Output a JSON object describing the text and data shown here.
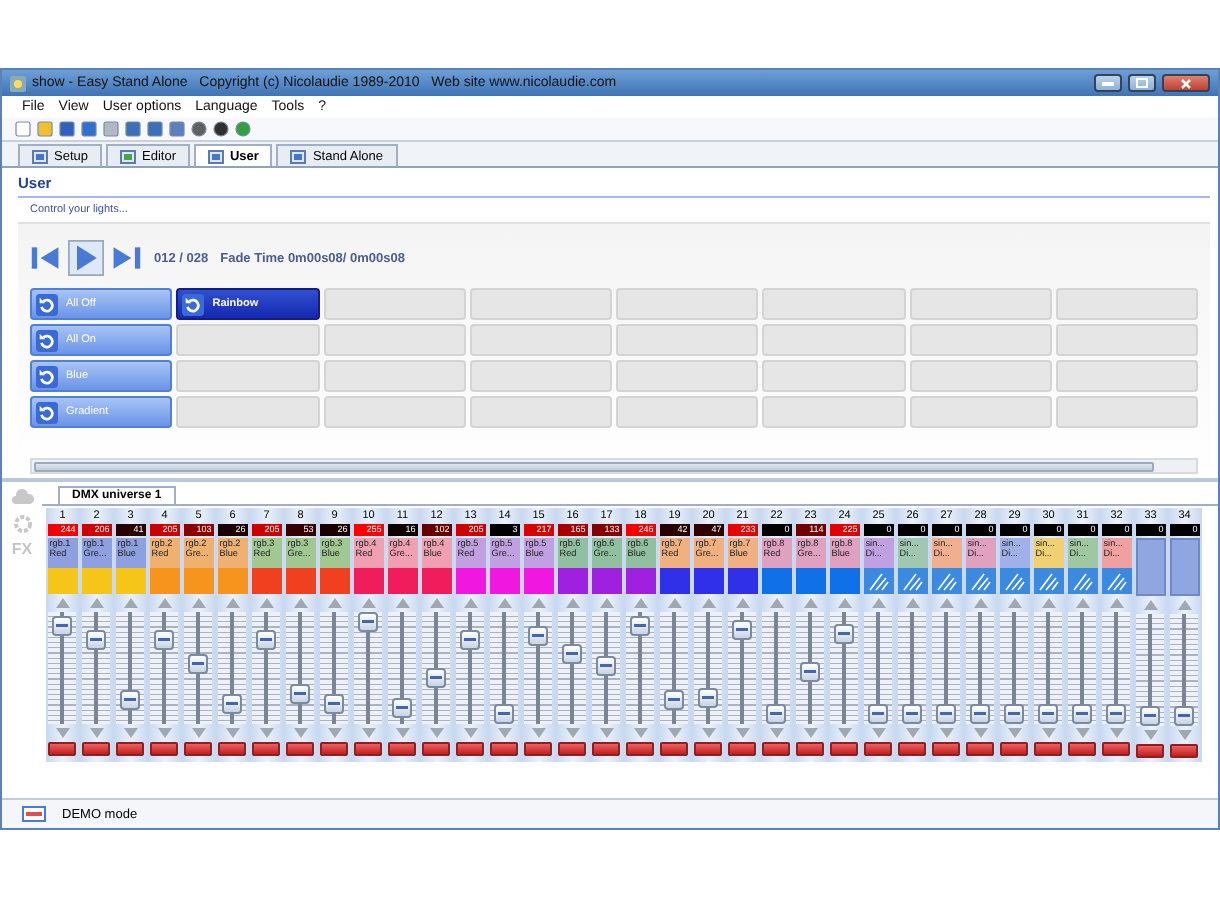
{
  "window": {
    "title": "show - Easy Stand Alone   Copyright (c) Nicolaudie 1989-2010   Web site www.nicolaudie.com"
  },
  "menu": [
    "File",
    "View",
    "User options",
    "Language",
    "Tools",
    "?"
  ],
  "tabs": [
    {
      "label": "Setup",
      "selected": false
    },
    {
      "label": "Editor",
      "selected": false
    },
    {
      "label": "User",
      "selected": true
    },
    {
      "label": "Stand Alone",
      "selected": false
    }
  ],
  "user_panel": {
    "title": "User",
    "subtitle": "Control your lights...",
    "counter": "012 / 028",
    "fade_time": "Fade Time 0m00s08/ 0m00s08",
    "rows": [
      [
        {
          "kind": "scene",
          "label": "All Off",
          "selected": false
        },
        {
          "kind": "scene",
          "label": "Rainbow",
          "selected": true
        },
        {
          "kind": "empty"
        },
        {
          "kind": "empty"
        },
        {
          "kind": "empty"
        },
        {
          "kind": "empty"
        },
        {
          "kind": "empty"
        },
        {
          "kind": "empty"
        }
      ],
      [
        {
          "kind": "scene",
          "label": "All On",
          "selected": false
        },
        {
          "kind": "empty"
        },
        {
          "kind": "empty"
        },
        {
          "kind": "empty"
        },
        {
          "kind": "empty"
        },
        {
          "kind": "empty"
        },
        {
          "kind": "empty"
        },
        {
          "kind": "empty"
        }
      ],
      [
        {
          "kind": "scene",
          "label": "Blue",
          "selected": false
        },
        {
          "kind": "empty"
        },
        {
          "kind": "empty"
        },
        {
          "kind": "empty"
        },
        {
          "kind": "empty"
        },
        {
          "kind": "empty"
        },
        {
          "kind": "empty"
        },
        {
          "kind": "empty"
        }
      ],
      [
        {
          "kind": "scene",
          "label": "Gradient",
          "selected": false
        },
        {
          "kind": "empty"
        },
        {
          "kind": "empty"
        },
        {
          "kind": "empty"
        },
        {
          "kind": "empty"
        },
        {
          "kind": "empty"
        },
        {
          "kind": "empty"
        },
        {
          "kind": "empty"
        }
      ]
    ]
  },
  "dmx": {
    "side_label": "FX",
    "tab": "DMX universe 1",
    "channels": [
      {
        "number": "1",
        "value": "244",
        "level": 0.96,
        "kind": "rgb",
        "tag": {
          "label": "rgb.1 Red",
          "color": "#8fa0e0"
        },
        "color": "#f5c518"
      },
      {
        "number": "2",
        "value": "206",
        "level": 0.81,
        "kind": "rgb",
        "tag": {
          "label": "rgb.1 Gre...",
          "color": "#8fa0e0"
        },
        "color": "#f5c518"
      },
      {
        "number": "3",
        "value": "41",
        "level": 0.16,
        "kind": "rgb",
        "tag": {
          "label": "rgb.1 Blue",
          "color": "#8fa0e0"
        },
        "color": "#f5c518"
      },
      {
        "number": "4",
        "value": "205",
        "level": 0.8,
        "kind": "rgb",
        "tag": {
          "label": "rgb.2 Red",
          "color": "#f0b070"
        },
        "color": "#f7941d"
      },
      {
        "number": "5",
        "value": "103",
        "level": 0.55,
        "kind": "rgb",
        "tag": {
          "label": "rgb.2 Gre...",
          "color": "#f0b070"
        },
        "color": "#f7941d"
      },
      {
        "number": "6",
        "value": "26",
        "level": 0.1,
        "kind": "rgb",
        "tag": {
          "label": "rgb.2 Blue",
          "color": "#f0b070"
        },
        "color": "#f7941d"
      },
      {
        "number": "7",
        "value": "205",
        "level": 0.8,
        "kind": "rgb",
        "tag": {
          "label": "rgb.3 Red",
          "color": "#a0c890"
        },
        "color": "#f04020"
      },
      {
        "number": "8",
        "value": "53",
        "level": 0.21,
        "kind": "rgb",
        "tag": {
          "label": "rgb.3 Gre...",
          "color": "#a0c890"
        },
        "color": "#f04020"
      },
      {
        "number": "9",
        "value": "26",
        "level": 0.1,
        "kind": "rgb",
        "tag": {
          "label": "rgb.3 Blue",
          "color": "#a0c890"
        },
        "color": "#f04020"
      },
      {
        "number": "10",
        "value": "255",
        "level": 1,
        "kind": "rgb",
        "tag": {
          "label": "rgb.4 Red",
          "color": "#f0a0b0"
        },
        "color": "#f01c5c"
      },
      {
        "number": "11",
        "value": "16",
        "level": 0.06,
        "kind": "rgb",
        "tag": {
          "label": "rgb.4 Gre...",
          "color": "#f0a0b0"
        },
        "color": "#f01c5c"
      },
      {
        "number": "12",
        "value": "102",
        "level": 0.4,
        "kind": "rgb",
        "tag": {
          "label": "rgb.4 Blue",
          "color": "#f0a0b0"
        },
        "color": "#f01c5c"
      },
      {
        "number": "13",
        "value": "205",
        "level": 0.8,
        "kind": "rgb",
        "tag": {
          "label": "rgb.5 Red",
          "color": "#c0a0e0"
        },
        "color": "#f018e0"
      },
      {
        "number": "14",
        "value": "3",
        "level": 0.01,
        "kind": "rgb",
        "tag": {
          "label": "rgb.5 Gre...",
          "color": "#c0a0e0"
        },
        "color": "#f018e0"
      },
      {
        "number": "15",
        "value": "217",
        "level": 0.85,
        "kind": "rgb",
        "tag": {
          "label": "rgb.5 Blue",
          "color": "#c0a0e0"
        },
        "color": "#f018e0"
      },
      {
        "number": "16",
        "value": "165",
        "level": 0.65,
        "kind": "rgb",
        "tag": {
          "label": "rgb.6 Red",
          "color": "#90c0a0"
        },
        "color": "#a020e0"
      },
      {
        "number": "17",
        "value": "133",
        "level": 0.52,
        "kind": "rgb",
        "tag": {
          "label": "rgb.6 Gre...",
          "color": "#90c0a0"
        },
        "color": "#a020e0"
      },
      {
        "number": "18",
        "value": "246",
        "level": 0.96,
        "kind": "rgb",
        "tag": {
          "label": "rgb.6 Blue",
          "color": "#90c0a0"
        },
        "color": "#a020e0"
      },
      {
        "number": "19",
        "value": "42",
        "level": 0.16,
        "kind": "rgb",
        "tag": {
          "label": "rgb.7 Red",
          "color": "#f0b080"
        },
        "color": "#3030e8"
      },
      {
        "number": "20",
        "value": "47",
        "level": 0.18,
        "kind": "rgb",
        "tag": {
          "label": "rgb.7 Gre...",
          "color": "#f0b080"
        },
        "color": "#3030e8"
      },
      {
        "number": "21",
        "value": "233",
        "level": 0.91,
        "kind": "rgb",
        "tag": {
          "label": "rgb.7 Blue",
          "color": "#f0b080"
        },
        "color": "#3030e8"
      },
      {
        "number": "22",
        "value": "0",
        "level": 0,
        "kind": "rgb",
        "tag": {
          "label": "rgb.8 Red",
          "color": "#e0a0c0"
        },
        "color": "#1070e8"
      },
      {
        "number": "23",
        "value": "114",
        "level": 0.45,
        "kind": "rgb",
        "tag": {
          "label": "rgb.8 Gre...",
          "color": "#e0a0c0"
        },
        "color": "#1070e8"
      },
      {
        "number": "24",
        "value": "225",
        "level": 0.88,
        "kind": "rgb",
        "tag": {
          "label": "rgb.8 Blue",
          "color": "#e0a0c0"
        },
        "color": "#1070e8"
      },
      {
        "number": "25",
        "value": "0",
        "level": 0,
        "kind": "pattern",
        "tag": {
          "label": "sin... Di...",
          "color": "#c0a0e0"
        }
      },
      {
        "number": "26",
        "value": "0",
        "level": 0,
        "kind": "pattern",
        "tag": {
          "label": "sin... Di...",
          "color": "#a0c8b0"
        }
      },
      {
        "number": "27",
        "value": "0",
        "level": 0,
        "kind": "pattern",
        "tag": {
          "label": "sin... Di...",
          "color": "#f0b090"
        }
      },
      {
        "number": "28",
        "value": "0",
        "level": 0,
        "kind": "pattern",
        "tag": {
          "label": "sin... Di...",
          "color": "#e0a0c0"
        }
      },
      {
        "number": "29",
        "value": "0",
        "level": 0,
        "kind": "pattern",
        "tag": {
          "label": "sin... Di...",
          "color": "#a0b0e8"
        }
      },
      {
        "number": "30",
        "value": "0",
        "level": 0,
        "kind": "pattern",
        "tag": {
          "label": "sin... Di...",
          "color": "#f0d070"
        }
      },
      {
        "number": "31",
        "value": "0",
        "level": 0,
        "kind": "pattern",
        "tag": {
          "label": "sin... Di...",
          "color": "#a0c8a0"
        }
      },
      {
        "number": "32",
        "value": "0",
        "level": 0,
        "kind": "pattern",
        "tag": {
          "label": "sin... Di...",
          "color": "#f0a0a0"
        }
      },
      {
        "number": "33",
        "value": "0",
        "level": 0,
        "kind": "empty"
      },
      {
        "number": "34",
        "value": "0",
        "level": 0,
        "kind": "empty"
      }
    ]
  },
  "status_bar": {
    "text": "DEMO mode"
  }
}
